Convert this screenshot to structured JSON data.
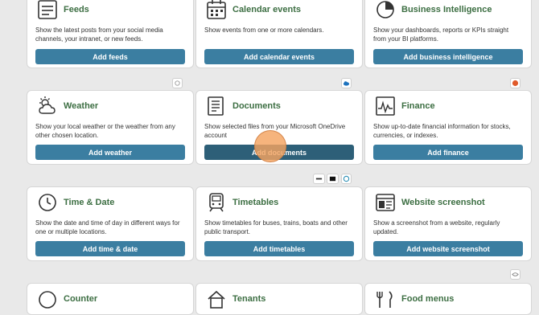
{
  "colors": {
    "background": "#e9e9e9",
    "title_green": "#3c6e42",
    "button_blue": "#3b7ea1",
    "button_active": "#2d5f78",
    "cursor_orange": "#f4a460"
  },
  "cards": [
    {
      "id": "feeds",
      "icon": "feeds-icon",
      "title": "Feeds",
      "desc": "Show the latest posts from your social media channels, your intranet, or new feeds.",
      "button": "Add feeds"
    },
    {
      "id": "calendar",
      "icon": "calendar-icon",
      "title": "Calendar events",
      "desc": "Show events from one or more calendars.",
      "button": "Add calendar events"
    },
    {
      "id": "bi",
      "icon": "pie-chart-icon",
      "title": "Business Intelligence",
      "desc": "Show your dashboards, reports or KPIs straight from your BI platforms.",
      "button": "Add business intelligence"
    },
    {
      "id": "weather",
      "icon": "weather-icon",
      "title": "Weather",
      "desc": "Show your local weather or the weather from any other chosen location.",
      "button": "Add weather"
    },
    {
      "id": "documents",
      "icon": "document-icon",
      "title": "Documents",
      "desc": "Show selected files from your Microsoft OneDrive account",
      "button": "Add documents"
    },
    {
      "id": "finance",
      "icon": "finance-chart-icon",
      "title": "Finance",
      "desc": "Show up-to-date financial information for stocks, currencies, or indexes.",
      "button": "Add finance"
    },
    {
      "id": "timedate",
      "icon": "clock-icon",
      "title": "Time & Date",
      "desc": "Show the date and time of day in different ways for one or multiple locations.",
      "button": "Add time & date"
    },
    {
      "id": "timetables",
      "icon": "train-icon",
      "title": "Timetables",
      "desc": "Show timetables for buses, trains, boats and other public transport.",
      "button": "Add timetables"
    },
    {
      "id": "website",
      "icon": "website-icon",
      "title": "Website screenshot",
      "desc": "Show a screenshot from a website, regularly updated.",
      "button": "Add website screenshot"
    },
    {
      "id": "counter",
      "icon": "counter-icon",
      "title": "Counter",
      "desc": "",
      "button": ""
    },
    {
      "id": "tenants",
      "icon": "tenants-icon",
      "title": "Tenants",
      "desc": "",
      "button": ""
    },
    {
      "id": "food",
      "icon": "food-icon",
      "title": "Food menus",
      "desc": "",
      "button": ""
    }
  ],
  "badges": {
    "weather": "weather-provider-icon",
    "documents": "onedrive-icon",
    "finance": "finance-provider-icon",
    "timetables": [
      "entur-logo-icon",
      "ruter-logo-icon",
      "transit-provider-icon"
    ],
    "food": "food-provider-icon"
  }
}
